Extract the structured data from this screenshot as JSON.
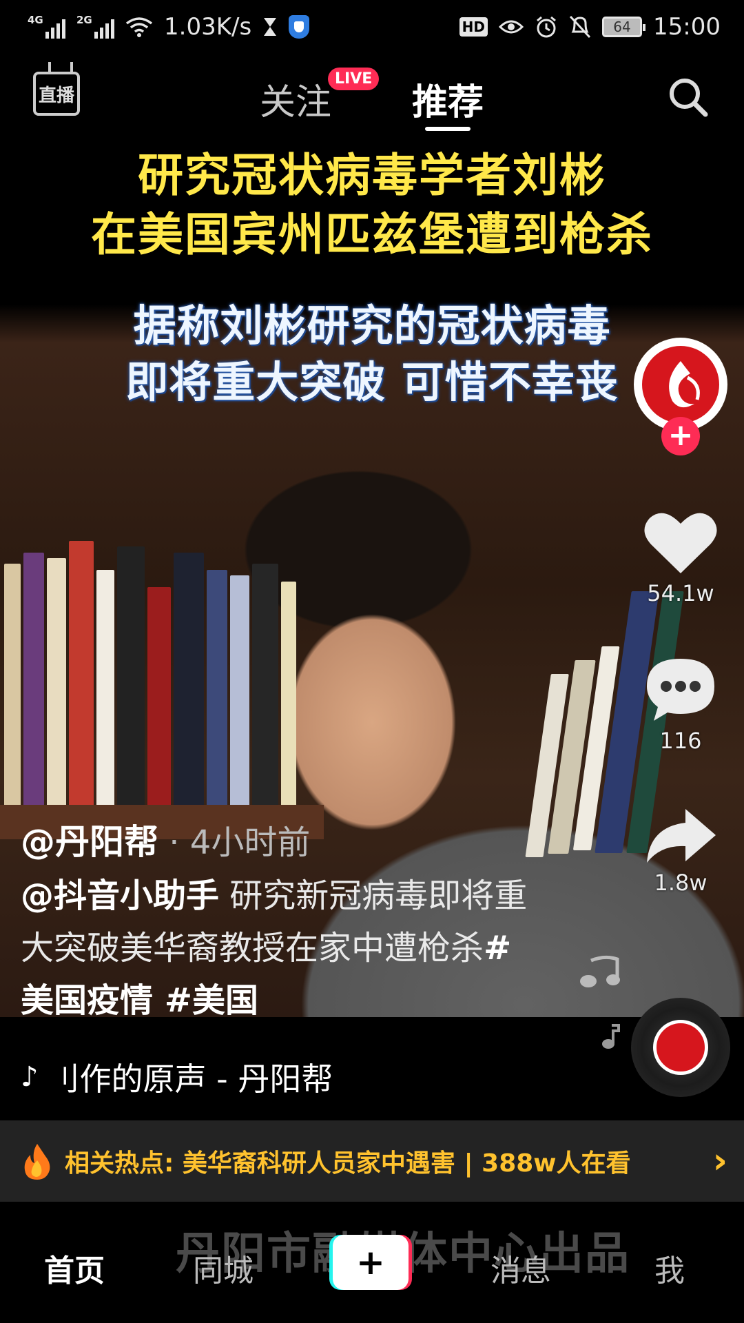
{
  "status_bar": {
    "net1": "4G",
    "net2": "2G",
    "speed": "1.03K/s",
    "hd": "HD",
    "battery": "64",
    "time": "15:00"
  },
  "top_nav": {
    "live_tv_label": "直播",
    "tab_follow": "关注",
    "live_badge": "LIVE",
    "tab_recommend": "推荐"
  },
  "video": {
    "headline_line1": "研究冠状病毒学者刘彬",
    "headline_line2": "在美国宾州匹兹堡遭到枪杀",
    "subhead_line1": "据称刘彬研究的冠状病毒",
    "subhead_line2": "即将重大突破 可惜不幸丧"
  },
  "actions": {
    "likes": "54.1w",
    "comments": "116",
    "shares": "1.8w"
  },
  "post": {
    "author": "@丹阳帮",
    "time": " · 4小时前",
    "mention": "@抖音小助手",
    "caption_text1": " 研究新冠病毒即将重大突破美华裔教授在家中遭枪杀",
    "tag1": "#美国疫情",
    "tag2": " #美国",
    "music": "刂作的原声 - 丹阳帮"
  },
  "hot": {
    "text": "相关热点: 美华裔科研人员家中遇害 | 388w人在看",
    "chevron": "›"
  },
  "watermark": "丹阳市融媒体中心出品",
  "tab_bar": {
    "home": "首页",
    "city": "同城",
    "create": "+",
    "messages": "消息",
    "me": "我"
  },
  "colors": {
    "headline_yellow": "#ffe84a",
    "accent_red": "#fe2c55",
    "hot_yellow": "#ffc22e",
    "tiktok_cyan": "#25f4ee"
  },
  "icons": [
    "live-tv-icon",
    "search-icon",
    "heart-icon",
    "comment-icon",
    "share-icon",
    "music-note-icon",
    "fire-icon",
    "chevron-right-icon",
    "plus-icon"
  ]
}
